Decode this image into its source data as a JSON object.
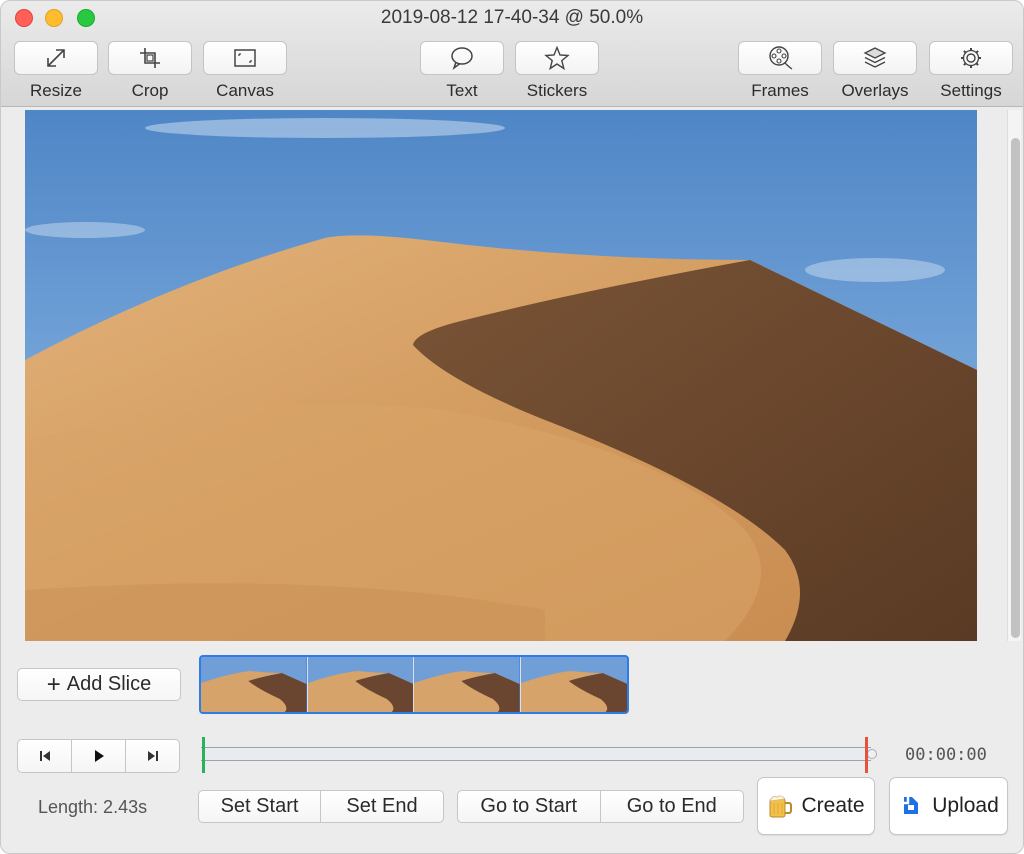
{
  "window": {
    "title": "2019-08-12 17-40-34 @ 50.0%"
  },
  "toolbar": {
    "left": [
      {
        "label": "Resize",
        "icon": "resize-icon"
      },
      {
        "label": "Crop",
        "icon": "crop-icon"
      },
      {
        "label": "Canvas",
        "icon": "canvas-icon"
      }
    ],
    "center": [
      {
        "label": "Text",
        "icon": "speech-bubble-icon"
      },
      {
        "label": "Stickers",
        "icon": "star-icon"
      }
    ],
    "right": [
      {
        "label": "Frames",
        "icon": "film-reel-icon"
      },
      {
        "label": "Overlays",
        "icon": "layers-icon"
      },
      {
        "label": "Settings",
        "icon": "gear-icon"
      }
    ]
  },
  "slices": {
    "add_label": "Add Slice",
    "thumbnail_count": 4
  },
  "playback": {
    "timecode": "00:00:00",
    "length_label": "Length: 2.43s",
    "start_marker_color": "#27b35a",
    "end_marker_color": "#e5533c"
  },
  "actions": {
    "set_start": "Set Start",
    "set_end": "Set End",
    "go_to_start": "Go to Start",
    "go_to_end": "Go to End",
    "create": "Create",
    "upload": "Upload"
  },
  "colors": {
    "accent": "#2f7ce6"
  }
}
